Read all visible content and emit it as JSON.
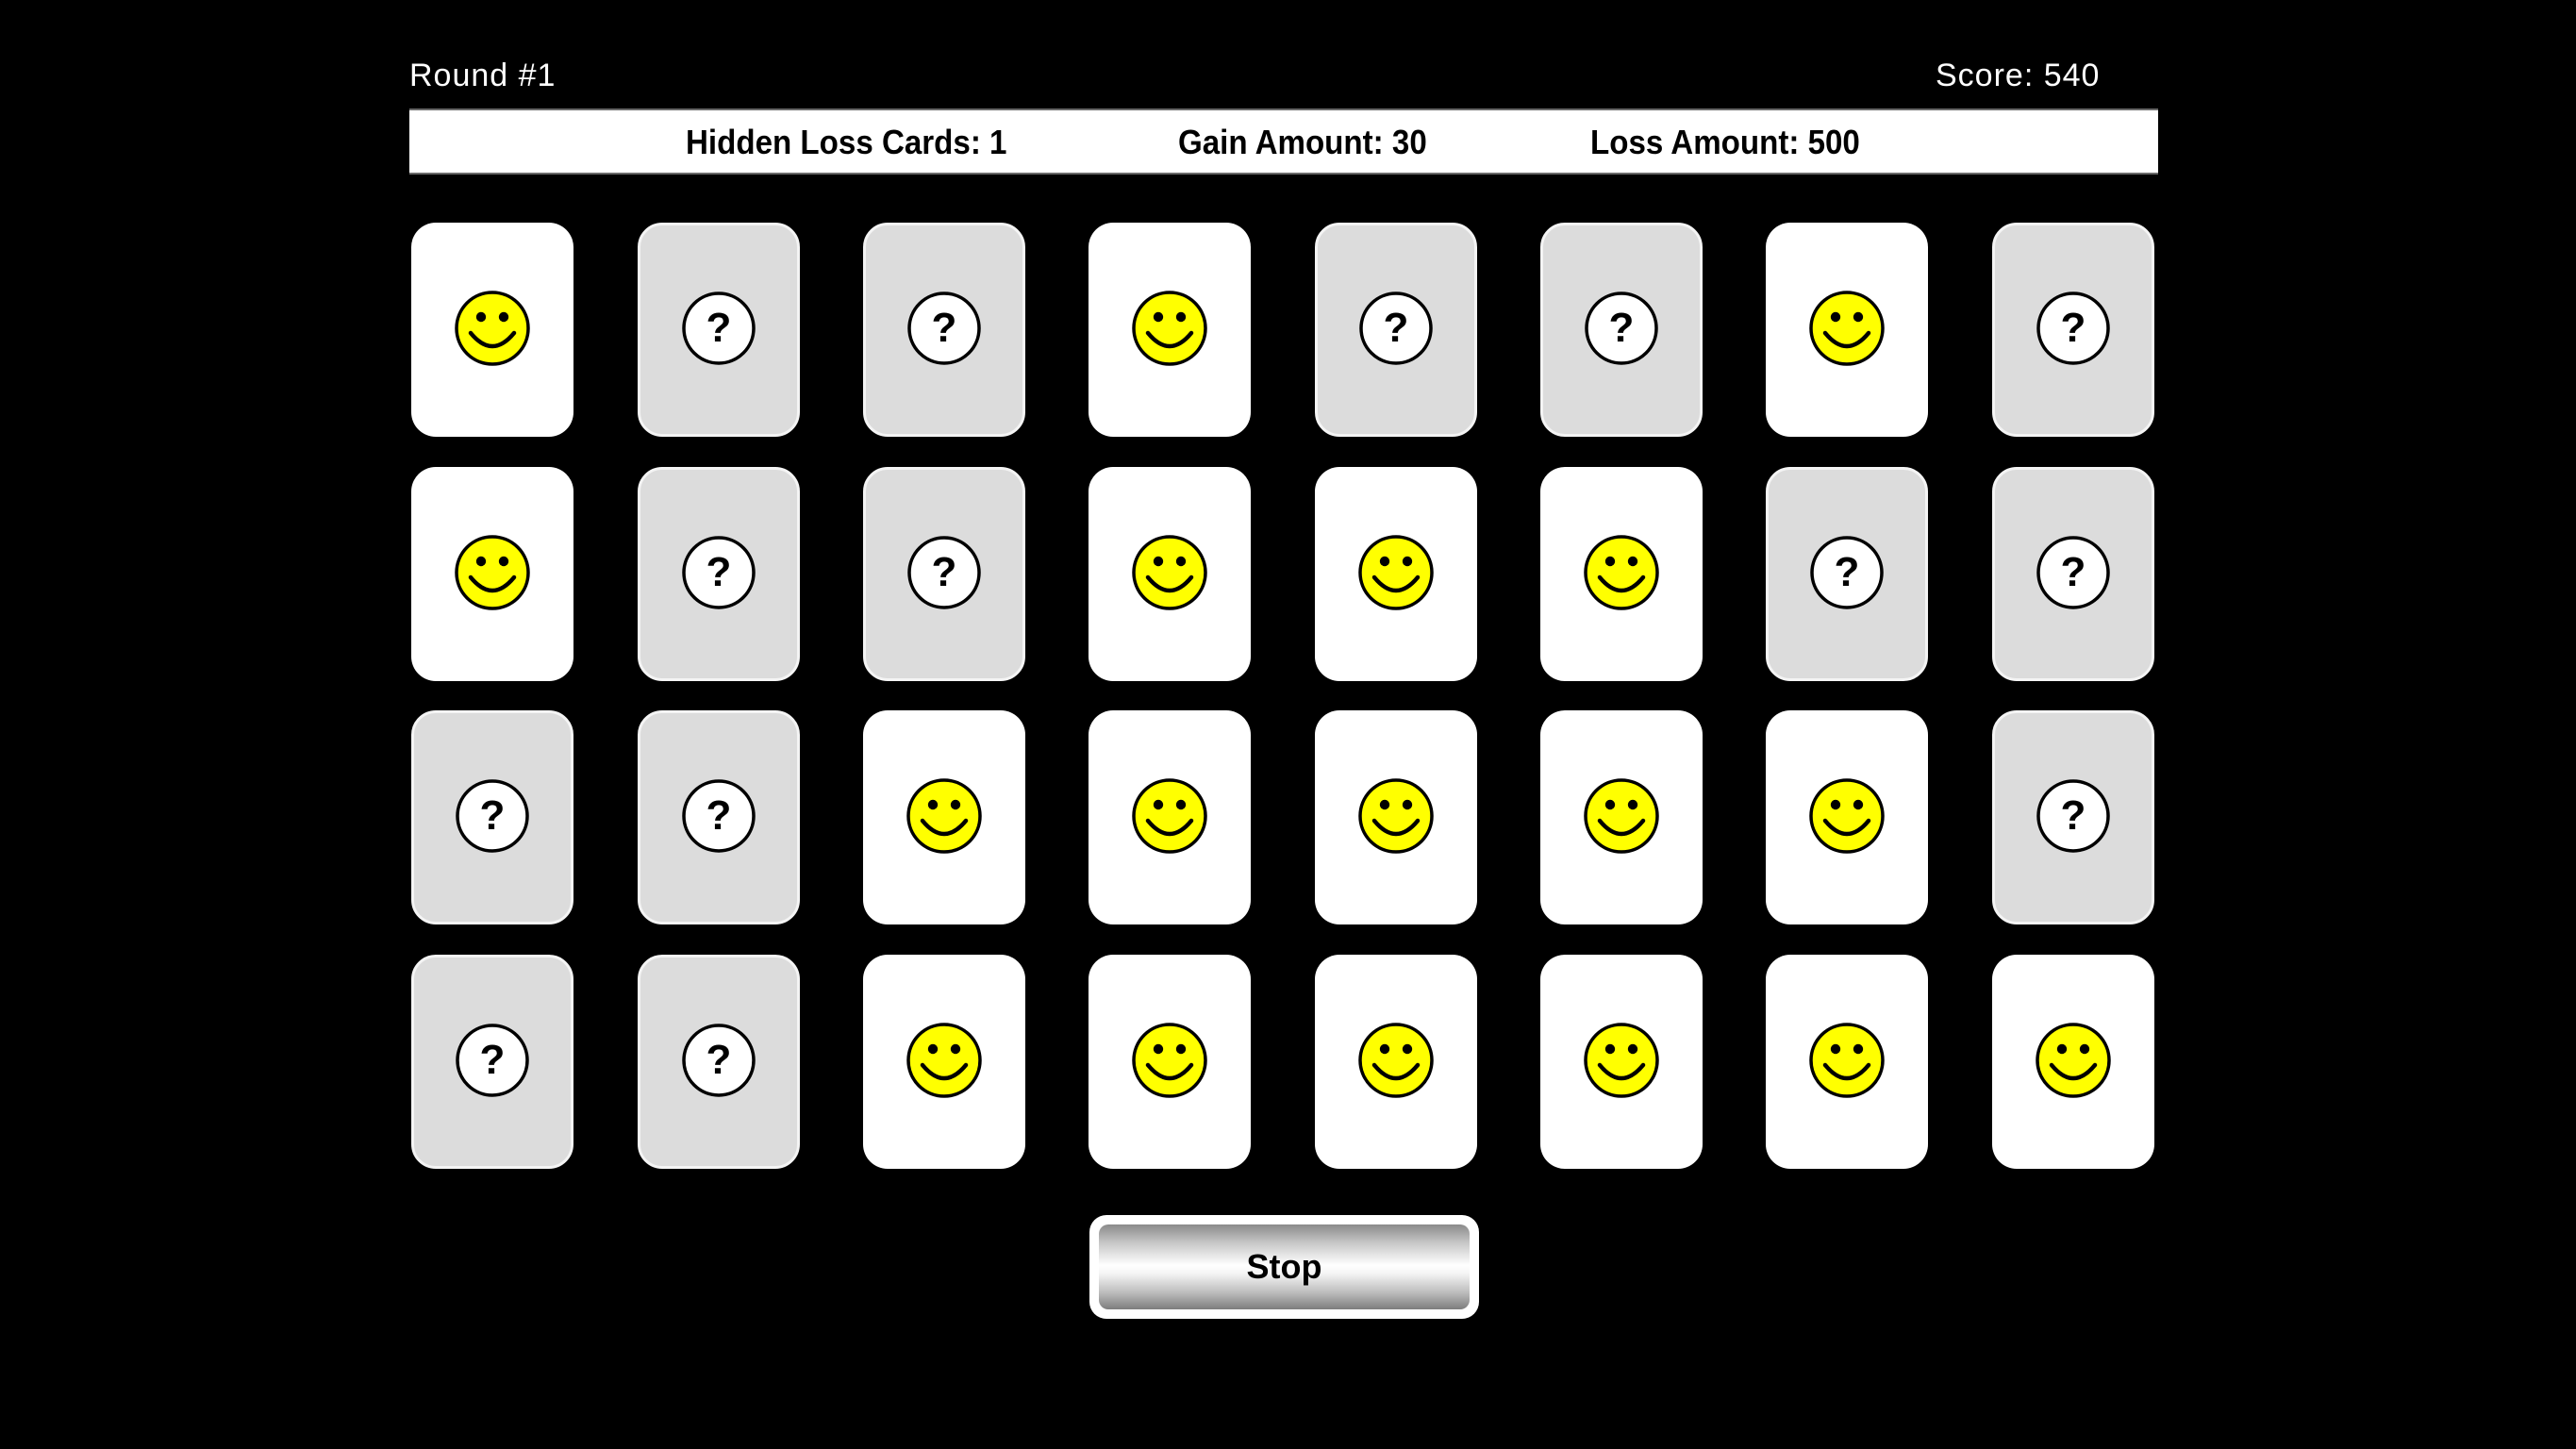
{
  "header": {
    "round_label": "Round #1",
    "score_label": "Score: 540"
  },
  "info_bar": {
    "hidden_loss_cards": "Hidden Loss Cards: 1",
    "gain_amount": "Gain Amount: 30",
    "loss_amount": "Loss Amount: 500"
  },
  "grid": {
    "rows": 4,
    "cols": 8,
    "cards": [
      [
        "revealed-gain",
        "hidden",
        "hidden",
        "revealed-gain",
        "hidden",
        "hidden",
        "revealed-gain",
        "hidden"
      ],
      [
        "revealed-gain",
        "hidden",
        "hidden",
        "revealed-gain",
        "revealed-gain",
        "revealed-gain",
        "hidden",
        "hidden"
      ],
      [
        "hidden",
        "hidden",
        "revealed-gain",
        "revealed-gain",
        "revealed-gain",
        "revealed-gain",
        "revealed-gain",
        "hidden"
      ],
      [
        "hidden",
        "hidden",
        "revealed-gain",
        "revealed-gain",
        "revealed-gain",
        "revealed-gain",
        "revealed-gain",
        "revealed-gain"
      ]
    ],
    "icons": {
      "revealed-gain": "smiley-face-icon",
      "hidden": "question-mark-icon"
    },
    "colors": {
      "smiley_fill": "#ffff00",
      "revealed_card": "#ffffff",
      "hidden_card": "#dcdcdc"
    }
  },
  "controls": {
    "stop_label": "Stop"
  }
}
